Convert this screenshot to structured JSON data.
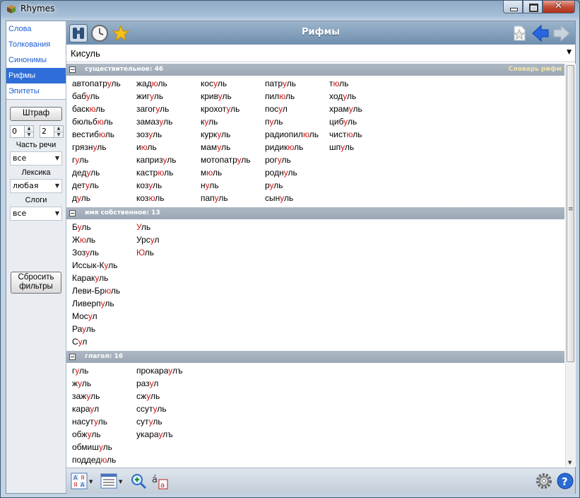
{
  "window": {
    "title": "Rhymes"
  },
  "sidebar": {
    "nav": [
      "Слова",
      "Толкования",
      "Синонимы",
      "Рифмы",
      "Эпитеты"
    ],
    "active_index": 3,
    "penalty_label": "Штраф",
    "spin_left": "0",
    "spin_right": "2",
    "part_of_speech_label": "Часть речи",
    "part_of_speech_value": "все",
    "lexicon_label": "Лексика",
    "lexicon_value": "любая",
    "syllables_label": "Слоги",
    "syllables_value": "все",
    "reset_label": "Сбросить фильтры"
  },
  "toolbar": {
    "title": "Рифмы"
  },
  "query": {
    "value": "Кисуль"
  },
  "sections": [
    {
      "label": "существительное: 46",
      "dict_link": "Словарь рифм",
      "columns": [
        [
          "автопатруль",
          "бабуль",
          "баскюль",
          "бюльбюль",
          "вестибюль",
          "грязнуль",
          "гуль",
          "дедуль",
          "детуль",
          "дуль"
        ],
        [
          "жадюль",
          "жигуль",
          "загогуль",
          "замазуль",
          "зозуль",
          "июль",
          "капризуль",
          "кастрюль",
          "козуль",
          "козюль"
        ],
        [
          "косуль",
          "кривуль",
          "крохотуль",
          "куль",
          "куркуль",
          "мамуль",
          "мотопатруль",
          "мюль",
          "нуль",
          "папуль"
        ],
        [
          "патруль",
          "пилюль",
          "посул",
          "пуль",
          "радиопилюль",
          "ридикюль",
          "рогуль",
          "роднуль",
          "руль",
          "сынуль"
        ],
        [
          "тюль",
          "ходуль",
          "храмуль",
          "цибуль",
          "чистюль",
          "шпуль"
        ]
      ]
    },
    {
      "label": "имя собственное: 13",
      "dict_link": "",
      "columns": [
        [
          "Буль",
          "Жюль",
          "Зозуль",
          "Иссык-Куль",
          "Каракуль",
          "Леви-Брюль",
          "Ливерпуль",
          "Мосул",
          "Рауль",
          "Сул"
        ],
        [
          "Уль",
          "Урсул",
          "Юль"
        ]
      ]
    },
    {
      "label": "глагол: 16",
      "dict_link": "",
      "columns": [
        [
          "гуль",
          "жуль",
          "зажуль",
          "караул",
          "насутуль",
          "обжуль",
          "обмишуль",
          "поддедюль"
        ],
        [
          "прокараулъ",
          "разул",
          "сжуль",
          "ссутуль",
          "сутуль",
          "укараулъ"
        ]
      ]
    }
  ],
  "colors": {
    "accent": "#2f6ed8",
    "rhyme_highlight": "#d01616",
    "link": "#1e5fd4"
  },
  "icons": {
    "toolbar": [
      "binoculars-icon",
      "clock-icon",
      "star-icon",
      "bookmark-icon",
      "back-arrow-icon",
      "forward-arrow-icon"
    ],
    "bottom": [
      "sort-icon",
      "view-options-icon",
      "zoom-icon",
      "font-size-icon",
      "settings-icon",
      "help-icon"
    ]
  }
}
